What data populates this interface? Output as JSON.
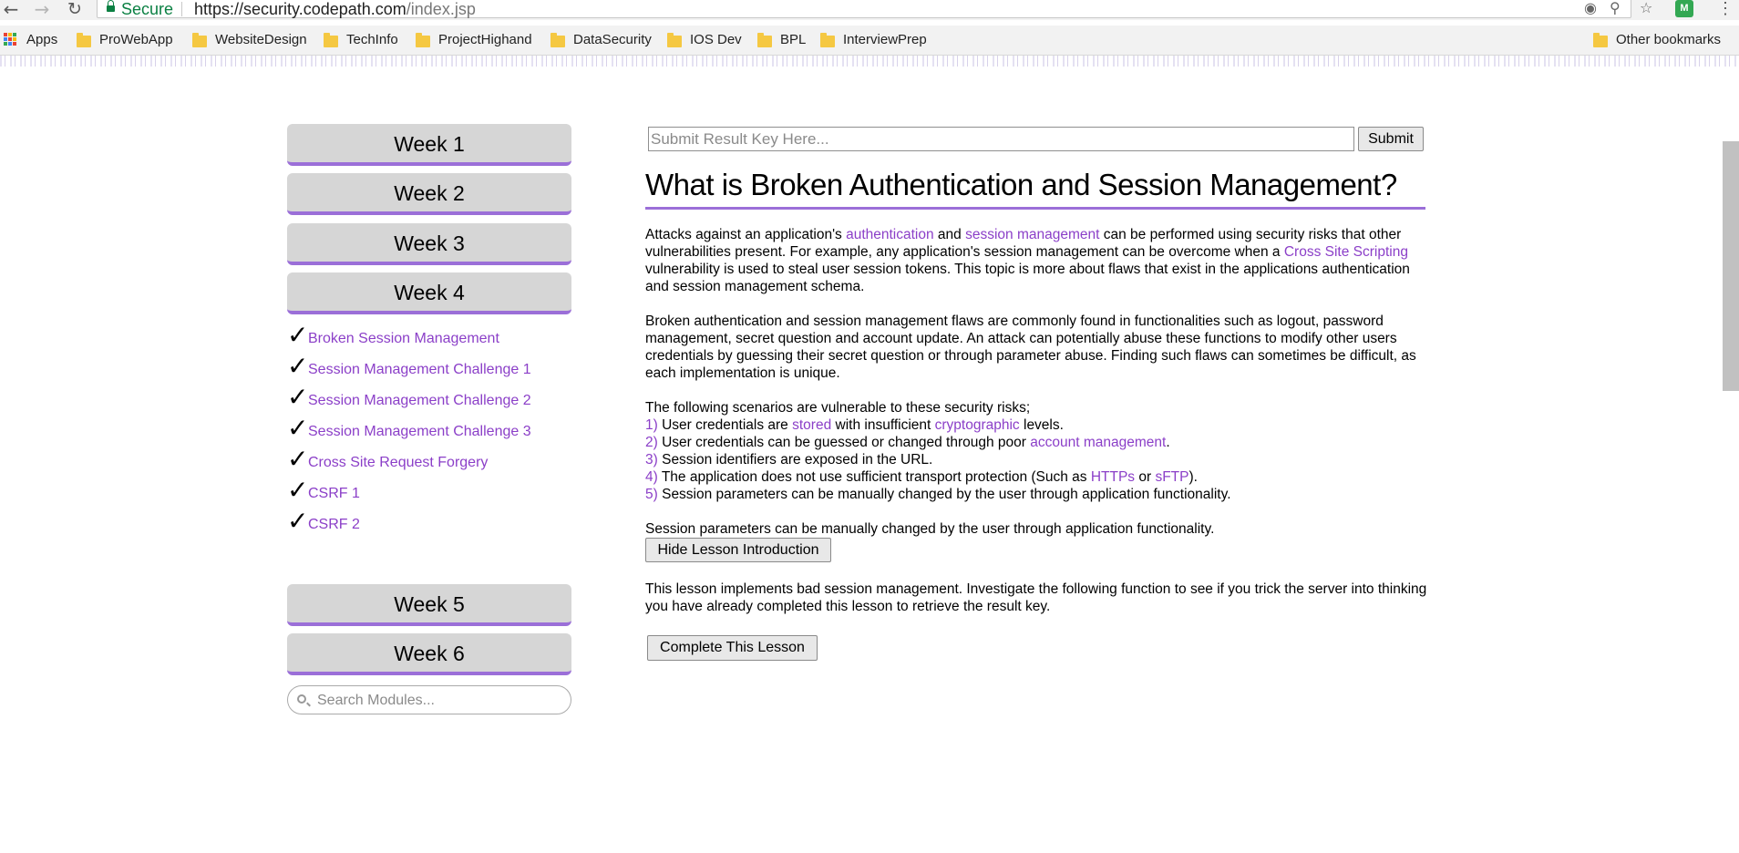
{
  "browser": {
    "secure_label": "Secure",
    "url_host": "https://security.codepath.com",
    "url_path": "/index.jsp",
    "extension_badge": "M",
    "bookmarks": [
      {
        "label": "Apps",
        "icon": "apps-grid-icon"
      },
      {
        "label": "ProWebApp",
        "icon": "folder-icon"
      },
      {
        "label": "WebsiteDesign",
        "icon": "folder-icon"
      },
      {
        "label": "TechInfo",
        "icon": "folder-icon"
      },
      {
        "label": "ProjectHighand",
        "icon": "folder-icon"
      },
      {
        "label": "DataSecurity",
        "icon": "folder-icon"
      },
      {
        "label": "IOS Dev",
        "icon": "folder-icon"
      },
      {
        "label": "BPL",
        "icon": "folder-icon"
      },
      {
        "label": "InterviewPrep",
        "icon": "folder-icon"
      }
    ],
    "other_bookmarks": "Other bookmarks"
  },
  "sidebar": {
    "weeks": [
      "Week 1",
      "Week 2",
      "Week 3",
      "Week 4",
      "Week 5",
      "Week 6"
    ],
    "check_mark": "✓",
    "lessons": [
      {
        "label": "Broken Session Management",
        "completed": true
      },
      {
        "label": "Session Management Challenge 1",
        "completed": true
      },
      {
        "label": "Session Management Challenge 2",
        "completed": true
      },
      {
        "label": "Session Management Challenge 3",
        "completed": true
      },
      {
        "label": "Cross Site Request Forgery",
        "completed": true
      },
      {
        "label": "CSRF 1",
        "completed": true
      },
      {
        "label": "CSRF 2",
        "completed": true
      }
    ],
    "search_placeholder": "Search Modules..."
  },
  "main": {
    "result_key_placeholder": "Submit Result Key Here...",
    "submit_label": "Submit",
    "title": "What is Broken Authentication and Session Management?",
    "p1": {
      "t1": "Attacks against an application's ",
      "l1": "authentication",
      "t2": " and ",
      "l2": "session management",
      "t3": " can be performed using security risks that other vulnerabilities present. For example, any application's session management can be overcome when a ",
      "l3": "Cross Site Scripting",
      "t4": " vulnerability is used to steal user session tokens. This topic is more about flaws that exist in the applications authentication and session management schema."
    },
    "p2": "Broken authentication and session management flaws are commonly found in functionalities such as logout, password management, secret question and account update. An attack can potentially abuse these functions to modify other users credentials by guessing their secret question or through parameter abuse. Finding such flaws can sometimes be difficult, as each implementation is unique.",
    "scenarios_intro": "The following scenarios are vulnerable to these security risks;",
    "s1": {
      "num": "1)",
      "t1": " User credentials are ",
      "l1": "stored",
      "t2": " with insufficient ",
      "l2": "cryptographic",
      "t3": " levels."
    },
    "s2": {
      "num": "2)",
      "t1": " User credentials can be guessed or changed through poor ",
      "l1": "account management",
      "t2": "."
    },
    "s3": {
      "num": "3)",
      "t1": " Session identifiers are exposed in the URL."
    },
    "s4": {
      "num": "4)",
      "t1": " The application does not use sufficient transport protection (Such as ",
      "l1": "HTTPs",
      "t2": " or ",
      "l2": "sFTP",
      "t3": ")."
    },
    "s5": {
      "num": "5)",
      "t1": " Session parameters can be manually changed by the user through application functionality."
    },
    "summary": "Session parameters can be manually changed by the user through application functionality.",
    "hide_intro_label": "Hide Lesson Introduction",
    "lesson_desc": "This lesson implements bad session management. Investigate the following function to see if you trick the server into thinking you have already completed this lesson to retrieve the result key.",
    "complete_label": "Complete This Lesson"
  },
  "colors": {
    "accent": "#9b6fd8",
    "link": "#8b3fc8",
    "secure": "#0b8043"
  }
}
